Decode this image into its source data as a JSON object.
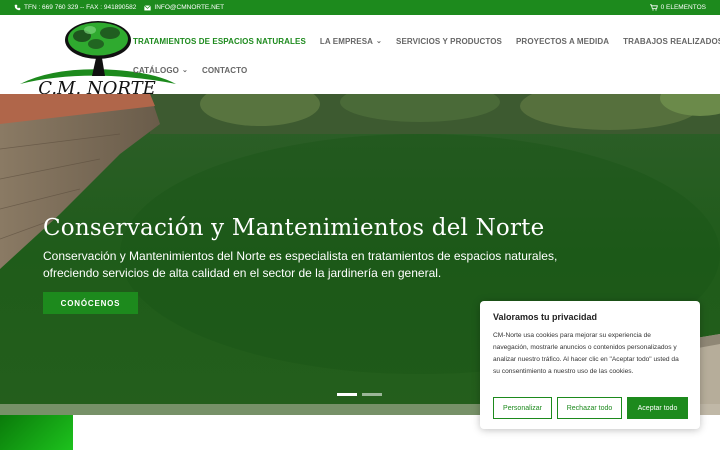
{
  "topbar": {
    "phone": "TFN : 669 760 329 -- FAX : 941890582",
    "email": "INFO@CMNORTE.NET",
    "cart": "0 ELEMENTOS"
  },
  "logo": {
    "text": "C.M. NORTE"
  },
  "nav": {
    "row1": [
      {
        "label": "TRATAMIENTOS DE ESPACIOS NATURALES",
        "dropdown": false,
        "active": true
      },
      {
        "label": "LA EMPRESA",
        "dropdown": true,
        "active": false
      },
      {
        "label": "SERVICIOS Y PRODUCTOS",
        "dropdown": false,
        "active": false
      },
      {
        "label": "PROYECTOS A MEDIDA",
        "dropdown": false,
        "active": false
      },
      {
        "label": "TRABAJOS REALIZADOS",
        "dropdown": false,
        "active": false
      }
    ],
    "row2": [
      {
        "label": "CATÁLOGO",
        "dropdown": true,
        "active": false
      },
      {
        "label": "CONTACTO",
        "dropdown": false,
        "active": false
      }
    ]
  },
  "hero": {
    "title": "Conservación y Mantenimientos del Norte",
    "text": "Conservación y Mantenimientos del Norte es especialista en tratamientos de espacios naturales, ofreciendo servicios de alta calidad en el sector de la jardinería en general.",
    "button": "CONÓCENOS",
    "slides": 2,
    "active_slide": 0
  },
  "cookie": {
    "title": "Valoramos tu privacidad",
    "text": "CM-Norte usa cookies para mejorar su experiencia de navegación, mostrarle anuncios o contenidos personalizados y analizar nuestro tráfico. Al hacer clic en \"Aceptar todo\" usted da su consentimiento a nuestro uso de las cookies.",
    "customize": "Personalizar",
    "reject": "Rechazar todo",
    "accept": "Aceptar todo"
  },
  "colors": {
    "brand": "#1d8a1d",
    "nav_text": "#666666"
  }
}
